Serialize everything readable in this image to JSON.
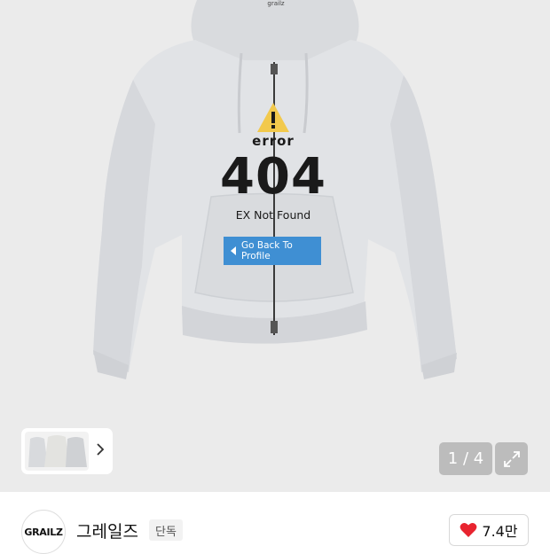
{
  "product": {
    "brand_tag": "grailz",
    "print": {
      "error": "error",
      "code": "404",
      "not_found": "EX Not Found",
      "back": "Go Back To Profile"
    },
    "image_counter": "1 / 4"
  },
  "seller": {
    "logo_text": "GRAILZ",
    "name": "그레일즈",
    "badge": "단독",
    "like_count": "7.4만"
  },
  "colors": {
    "background": "#ebebeb",
    "hoodie": "#dfe1e4",
    "banner": "#3f8fd3",
    "warning": "#f2c94c",
    "heart": "#e8242f"
  },
  "icons": {
    "thumb_next": "chevron-right-icon",
    "expand": "expand-icon",
    "like": "heart-icon"
  }
}
